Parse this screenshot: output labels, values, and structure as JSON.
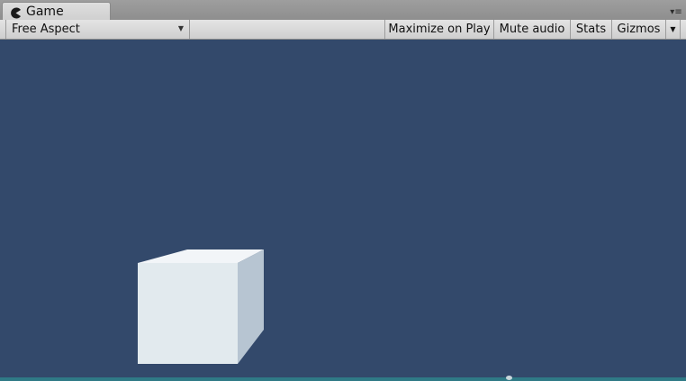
{
  "tab": {
    "title": "Game",
    "icon": "pacman-icon"
  },
  "panel_menu": {
    "icon": "panel-menu-icon",
    "glyph": "▾≡"
  },
  "toolbar": {
    "aspect_dropdown": {
      "selected": "Free Aspect",
      "arrow": "▼"
    },
    "maximize_label": "Maximize on Play",
    "mute_label": "Mute audio",
    "stats_label": "Stats",
    "gizmos_label": "Gizmos",
    "gizmos_arrow": "▼"
  },
  "viewport": {
    "background_color": "#33496b",
    "object": "cube"
  },
  "colors": {
    "cube_front": "#e2eaee",
    "cube_top": "#f2f5f8",
    "cube_side": "#b7c5d2"
  }
}
